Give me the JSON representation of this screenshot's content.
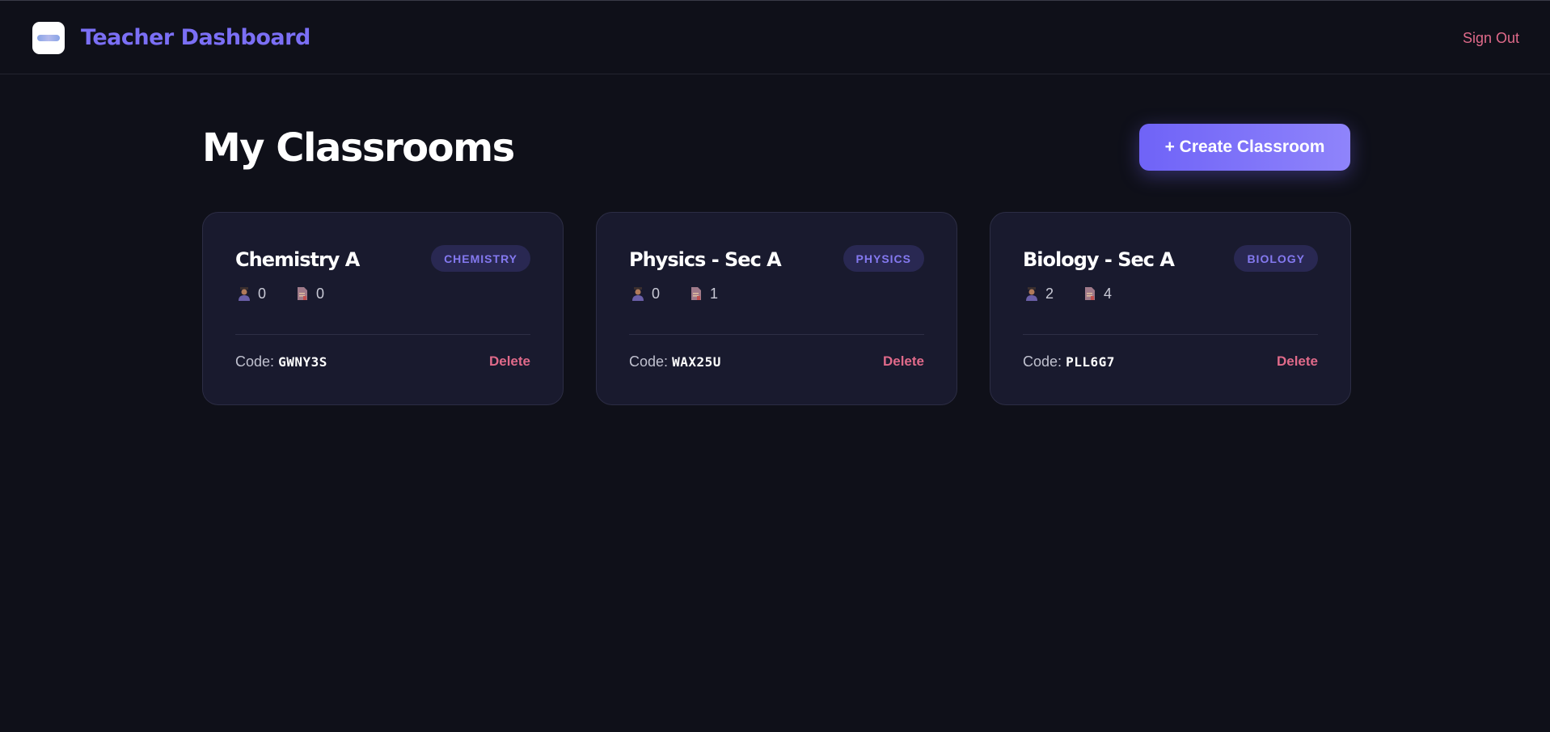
{
  "header": {
    "title": "Teacher Dashboard",
    "sign_out_label": "Sign Out"
  },
  "main": {
    "page_title": "My Classrooms",
    "create_button_label": "+ Create Classroom"
  },
  "classrooms": [
    {
      "name": "Chemistry A",
      "subject": "CHEMISTRY",
      "students": "0",
      "assignments": "0",
      "code_label": "Code:",
      "code": "GWNY3S",
      "delete_label": "Delete"
    },
    {
      "name": "Physics - Sec A",
      "subject": "PHYSICS",
      "students": "0",
      "assignments": "1",
      "code_label": "Code:",
      "code": "WAX25U",
      "delete_label": "Delete"
    },
    {
      "name": "Biology - Sec A",
      "subject": "BIOLOGY",
      "students": "2",
      "assignments": "4",
      "code_label": "Code:",
      "code": "PLL6G7",
      "delete_label": "Delete"
    }
  ],
  "icons": {
    "students": "student-icon",
    "assignments": "document-icon"
  },
  "colors": {
    "accent": "#7b6ff5",
    "danger": "#e06a8a",
    "background": "#0f1019",
    "card": "#191a2e"
  }
}
